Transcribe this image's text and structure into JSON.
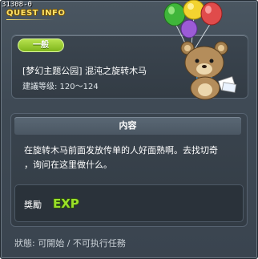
{
  "header": {
    "quest_id": "31308-0",
    "title": "QUEST INFO"
  },
  "info": {
    "badge": "一般",
    "quest_name": "[梦幻主题公园] 混沌之旋转木马",
    "level_requirement": "建議等级: 120～124"
  },
  "content": {
    "header": "内容",
    "text_line1": "在旋转木马前面发放传单的人好面熟啊。去找切奇",
    "text_line2": "，询问在这里做什么。"
  },
  "reward": {
    "label": "獎勵",
    "exp_text": "EXP"
  },
  "status": {
    "text": "狀態: 可開始 / 不可执行任務"
  },
  "colors": {
    "title": "#ffe36a",
    "badge": "#8cc52a",
    "panel": "#3a444e",
    "exp": "#9ae02a"
  },
  "icons": [
    "bear-with-balloons-icon",
    "exp-icon"
  ]
}
